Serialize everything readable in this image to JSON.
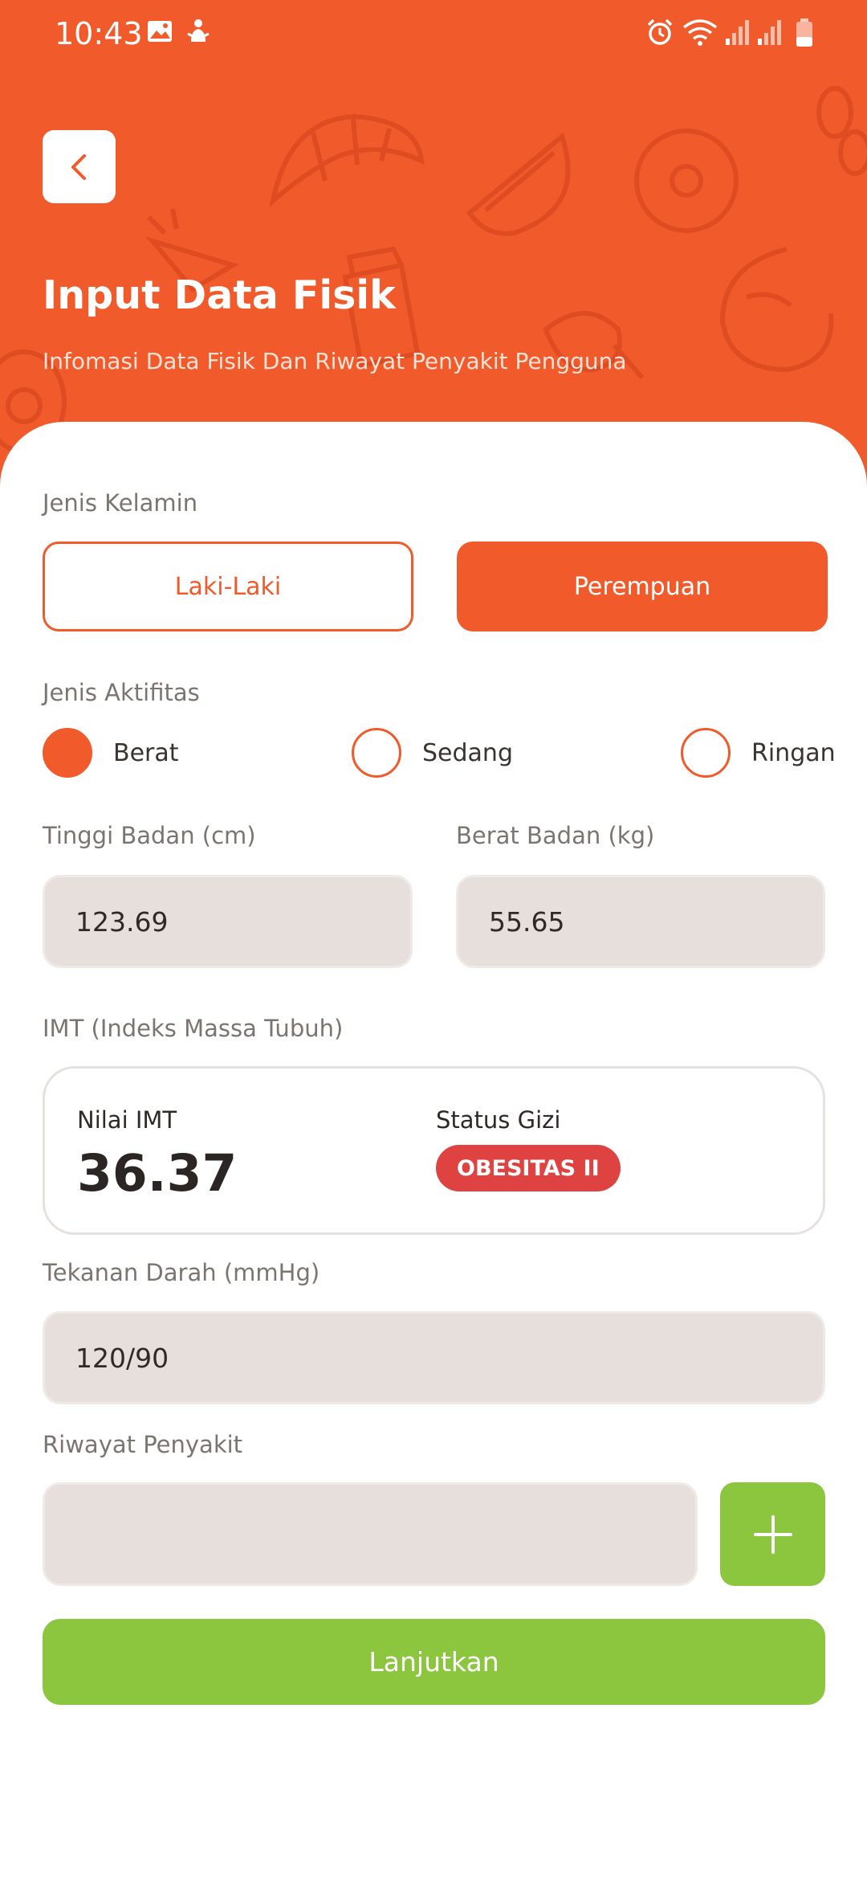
{
  "status_bar": {
    "time": "10:43",
    "left_icons": [
      "image-icon",
      "notification-icon"
    ],
    "right_icons": [
      "alarm-icon",
      "wifi-icon",
      "signal-icon",
      "signal-icon",
      "battery-icon"
    ]
  },
  "header": {
    "title": "Input Data Fisik",
    "subtitle": "Infomasi Data Fisik Dan Riwayat Penyakit Pengguna",
    "back_icon": "chevron-left-icon"
  },
  "form": {
    "gender": {
      "label": "Jenis Kelamin",
      "options": [
        "Laki-Laki",
        "Perempuan"
      ],
      "selected": "Perempuan"
    },
    "activity": {
      "label": "Jenis Aktifitas",
      "options": [
        "Berat",
        "Sedang",
        "Ringan"
      ],
      "selected": "Berat"
    },
    "height": {
      "label": "Tinggi Badan (cm)",
      "value": "123.69"
    },
    "weight": {
      "label": "Berat Badan (kg)",
      "value": "55.65"
    },
    "imt": {
      "label": "IMT (Indeks Massa Tubuh)",
      "value_label": "Nilai IMT",
      "value": "36.37",
      "status_label": "Status Gizi",
      "status": "OBESITAS II"
    },
    "blood_pressure": {
      "label": "Tekanan Darah (mmHg)",
      "value": "120/90"
    },
    "disease_history": {
      "label": "Riwayat Penyakit",
      "value": "",
      "add_icon": "plus-icon"
    },
    "submit_label": "Lanjutkan"
  },
  "colors": {
    "primary": "#F15A2B",
    "accent_green": "#8CC63F",
    "badge_red": "#DE4342",
    "input_bg": "#E6DFDB"
  }
}
